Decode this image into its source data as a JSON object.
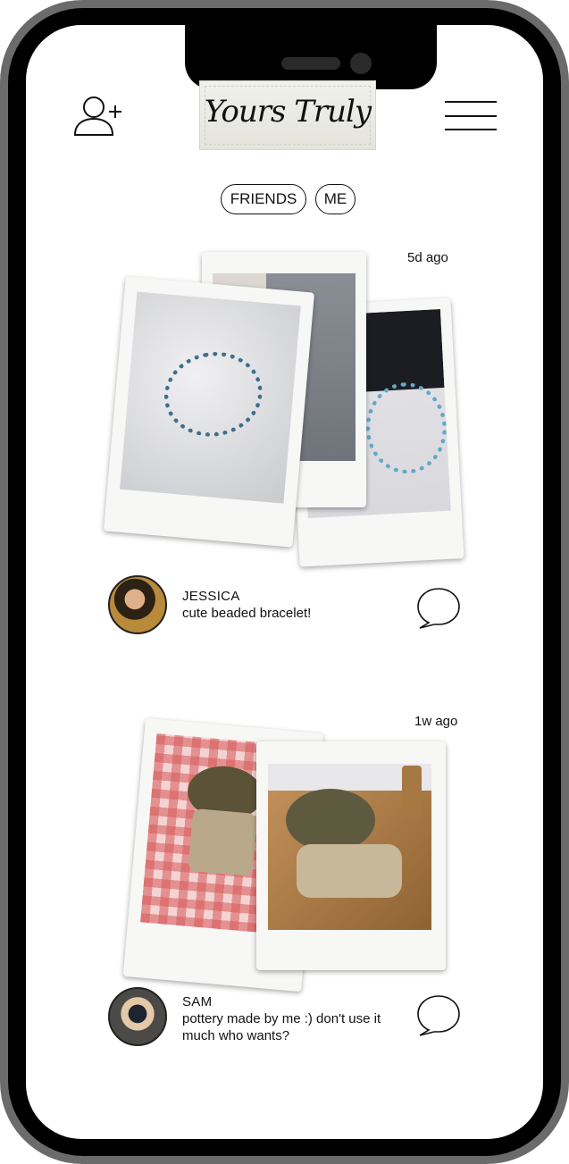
{
  "app": {
    "title": "Yours Truly"
  },
  "tabs": [
    {
      "label": "FRIENDS"
    },
    {
      "label": "ME"
    }
  ],
  "icons": {
    "add_friend": "add-user-icon",
    "menu": "hamburger-menu-icon",
    "comment": "speech-bubble-icon"
  },
  "posts": [
    {
      "time": "5d ago",
      "user": "JESSICA",
      "caption": "cute beaded bracelet!"
    },
    {
      "time": "1w ago",
      "user": "SAM",
      "caption": "pottery made by me :) don't use it much who wants?"
    }
  ]
}
